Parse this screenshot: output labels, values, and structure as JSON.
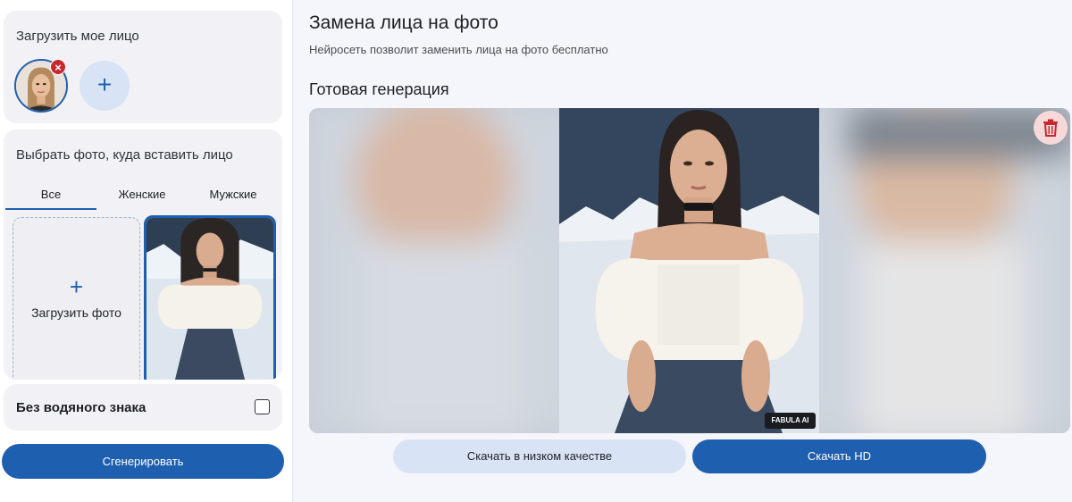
{
  "sidebar": {
    "upload_face_title": "Загрузить мое лицо",
    "remove_symbol": "×",
    "add_symbol": "+",
    "choose_photo_title": "Выбрать фото, куда вставить лицо",
    "tabs": [
      {
        "label": "Все",
        "active": true
      },
      {
        "label": "Женские",
        "active": false
      },
      {
        "label": "Мужские",
        "active": false
      }
    ],
    "upload_photo_plus": "+",
    "upload_photo_label": "Загрузить фото",
    "no_watermark_label": "Без водяного знака",
    "no_watermark_checked": false,
    "generate_label": "Сгенерировать"
  },
  "main": {
    "title": "Замена лица на фото",
    "subtitle": "Нейросеть позволит заменить лица на фото бесплатно",
    "result_title": "Готовая генерация",
    "watermark_text": "FABULA AI",
    "download_low_label": "Скачать в низком качестве",
    "download_hd_label": "Скачать HD"
  },
  "colors": {
    "accent": "#1f5fb0",
    "accent_light": "#d9e3f6",
    "danger": "#c8282b",
    "danger_light": "#f7d9d9"
  },
  "icons": [
    "close-icon",
    "plus-icon",
    "trash-icon",
    "checkbox-icon"
  ]
}
